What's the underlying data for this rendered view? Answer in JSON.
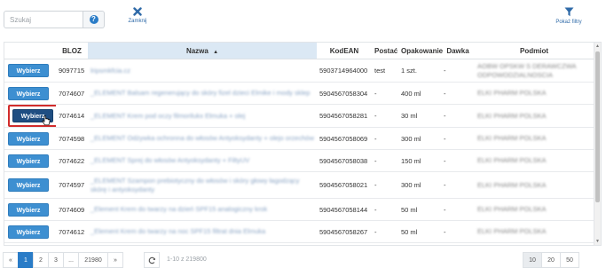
{
  "toolbar": {
    "search_placeholder": "Szukaj",
    "help_label": "?",
    "close_label": "Zamknij",
    "filter_label": "Pokaż filtry"
  },
  "table": {
    "columns": [
      "",
      "BLOZ",
      "Nazwa",
      "KodEAN",
      "Postać",
      "Opakowanie",
      "Dawka",
      "Podmiot"
    ],
    "sorted_column": "Nazwa",
    "sort_indicator": "▲",
    "select_label": "Wybierz",
    "rows": [
      {
        "bloz": "9097715",
        "nazwa": "lripsmkfcia.cz",
        "ean": "5903714964000",
        "postac": "test",
        "opak": "1 szt.",
        "dawka": "-",
        "podmiot": "AOBW OPSKW S DERAWCZWA ODPOWODZIALNOSCIA",
        "selected": false
      },
      {
        "bloz": "7074607",
        "nazwa": "_ELEMENT Balsam regenerujący do skóry fizel dzieci Elmike i mody sklep",
        "ean": "5904567058304",
        "postac": "-",
        "opak": "400 ml",
        "dawka": "-",
        "podmiot": "ELKI PHARM POLSKA",
        "selected": false
      },
      {
        "bloz": "7074614",
        "nazwa": "_ELEMENT Krem pod oczy filmorilukx Elmuka + olej",
        "ean": "5904567058281",
        "postac": "-",
        "opak": "30 ml",
        "dawka": "-",
        "podmiot": "ELKI PHARM POLSKA",
        "selected": true
      },
      {
        "bloz": "7074598",
        "nazwa": "_ELEMENT Odżywka ochronna do włosów Antyoksydanty + olejo orzechów",
        "ean": "5904567058069",
        "postac": "-",
        "opak": "300 ml",
        "dawka": "-",
        "podmiot": "ELKI PHARM POLSKA",
        "selected": false
      },
      {
        "bloz": "7074622",
        "nazwa": "_ELEMENT Sprej do włosów Antyoksydanty + FiltyUV",
        "ean": "5904567058038",
        "postac": "-",
        "opak": "150 ml",
        "dawka": "-",
        "podmiot": "ELKI PHARM POLSKA",
        "selected": false
      },
      {
        "bloz": "7074597",
        "nazwa": "_ELEMENT Szampon prebiotyczny do włosów i skóry głowy łagodzący skórę i antyoksydanty",
        "ean": "5904567058021",
        "postac": "-",
        "opak": "300 ml",
        "dawka": "-",
        "podmiot": "ELKI PHARM POLSKA",
        "selected": false
      },
      {
        "bloz": "7074609",
        "nazwa": "_Element Krem do twarzy na dzień SPF15 analogiczny krok",
        "ean": "5904567058144",
        "postac": "-",
        "opak": "50 ml",
        "dawka": "-",
        "podmiot": "ELKI PHARM POLSKA",
        "selected": false
      },
      {
        "bloz": "7074612",
        "nazwa": "_Element Krem do twarzy na noc SPF15 filtrat dnia Elmuka",
        "ean": "5904567058267",
        "postac": "-",
        "opak": "50 ml",
        "dawka": "-",
        "podmiot": "ELKI PHARM POLSKA",
        "selected": false
      }
    ]
  },
  "pager": {
    "prev": "«",
    "pages": [
      "1",
      "2",
      "3",
      "...",
      "21980"
    ],
    "next": "»",
    "active_page": "1",
    "count_text": "1-10 z 219800",
    "sizes": [
      "10",
      "20",
      "50"
    ],
    "active_size": "10"
  },
  "colors": {
    "accent": "#2a7cc7",
    "button": "#3d8fd1",
    "button_selected": "#1f4e82",
    "highlight": "#d22c2c"
  }
}
